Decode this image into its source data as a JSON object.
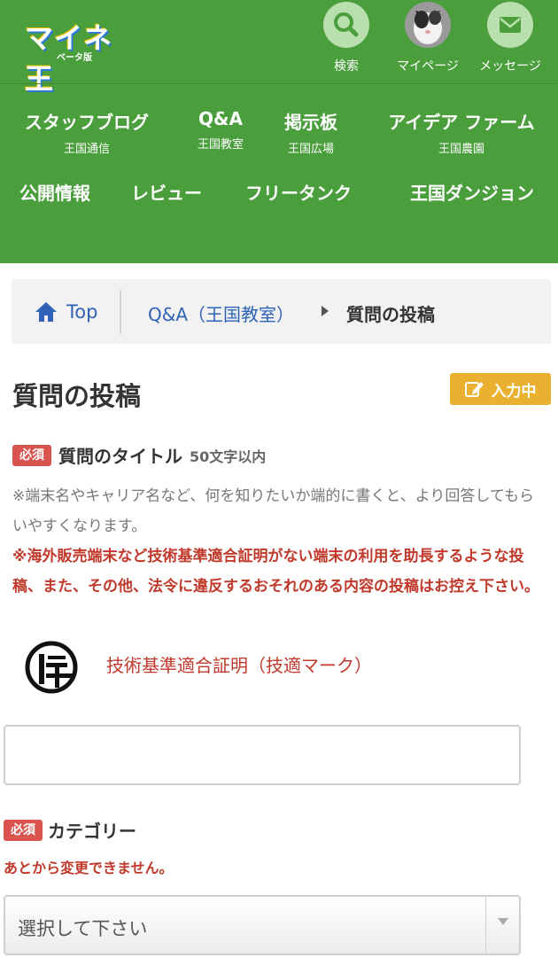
{
  "header": {
    "logo_text": "マイネ王",
    "logo_beta": "ベータ版",
    "icons": [
      {
        "label": "検索",
        "icon": "search-icon"
      },
      {
        "label": "マイページ",
        "icon": "avatar"
      },
      {
        "label": "メッセージ",
        "icon": "envelope-icon"
      }
    ],
    "nav": [
      {
        "label": "スタッフブログ",
        "sub": "王国通信"
      },
      {
        "label": "Q&A",
        "sub": "王国教室"
      },
      {
        "label": "掲示板",
        "sub": "王国広場"
      },
      {
        "label": "アイデア ファーム",
        "sub": "王国農園"
      },
      {
        "label": "公開情報"
      },
      {
        "label": "レビュー"
      },
      {
        "label": "フリータンク"
      },
      {
        "label": "王国ダンジョン"
      }
    ],
    "colors": {
      "background": "#4a9e3c",
      "icon_circle": "#b9dfae"
    }
  },
  "breadcrumb": {
    "home": "Top",
    "parent": "Q&A（王国教室）",
    "current": "質問の投稿"
  },
  "main": {
    "title": "質問の投稿",
    "status_badge": "入力中",
    "required_label": "必須",
    "question_title_label": "質問のタイトル",
    "question_title_limit": "50文字以内",
    "hint": "※端末名やキャリア名など、何を知りたいか端的に書くと、より回答してもらいやすくなります。",
    "warning": "※海外販売端末など技術基準適合証明がない端末の利用を助長するような投稿、また、その他、法令に違反するおそれのある内容の投稿はお控え下さい。",
    "tech_mark_link": "技術基準適合証明（技適マーク）",
    "title_input_value": "",
    "category_label": "カテゴリー",
    "category_note": "あとから変更できません。",
    "category_select_value": "選択して下さい",
    "colors": {
      "required": "#d9534f",
      "warning": "#c0392b",
      "badge": "#eab130",
      "link": "#2f63b8"
    }
  }
}
